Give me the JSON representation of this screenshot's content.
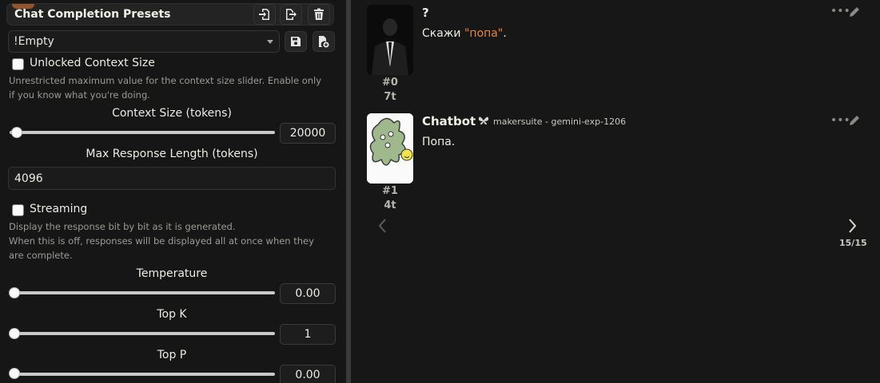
{
  "presets": {
    "title": "Chat Completion Presets",
    "selected": "!Empty"
  },
  "unlocked_context": {
    "label": "Unlocked Context Size",
    "hint": "Unrestricted maximum value for the context size slider. Enable only if you know what you're doing.",
    "checked": false
  },
  "context_size": {
    "label": "Context Size (tokens)",
    "value": "20000"
  },
  "max_response": {
    "label": "Max Response Length (tokens)",
    "value": "4096"
  },
  "streaming": {
    "label": "Streaming",
    "hint_line1": "Display the response bit by bit as it is generated.",
    "hint_line2": "When this is off, responses will be displayed all at once when they are complete.",
    "checked": false
  },
  "temperature": {
    "label": "Temperature",
    "value": "0.00"
  },
  "top_k": {
    "label": "Top K",
    "value": "1"
  },
  "top_p": {
    "label": "Top P",
    "value": "0.00"
  },
  "messages": [
    {
      "name": "?",
      "text_prefix": "Скажи ",
      "text_quote": "\"попа\"",
      "text_suffix": ".",
      "id": "#0",
      "tokens": "7t"
    },
    {
      "name": "Chatbot",
      "model": "makersuite - gemini-exp-1206",
      "text": "Попа.",
      "id": "#1",
      "tokens": "4t"
    }
  ],
  "swipe": {
    "counter": "15/15"
  },
  "colors": {
    "accent_quote": "#e3873e",
    "panel_bg": "#161616",
    "chat_bg": "#171717"
  }
}
